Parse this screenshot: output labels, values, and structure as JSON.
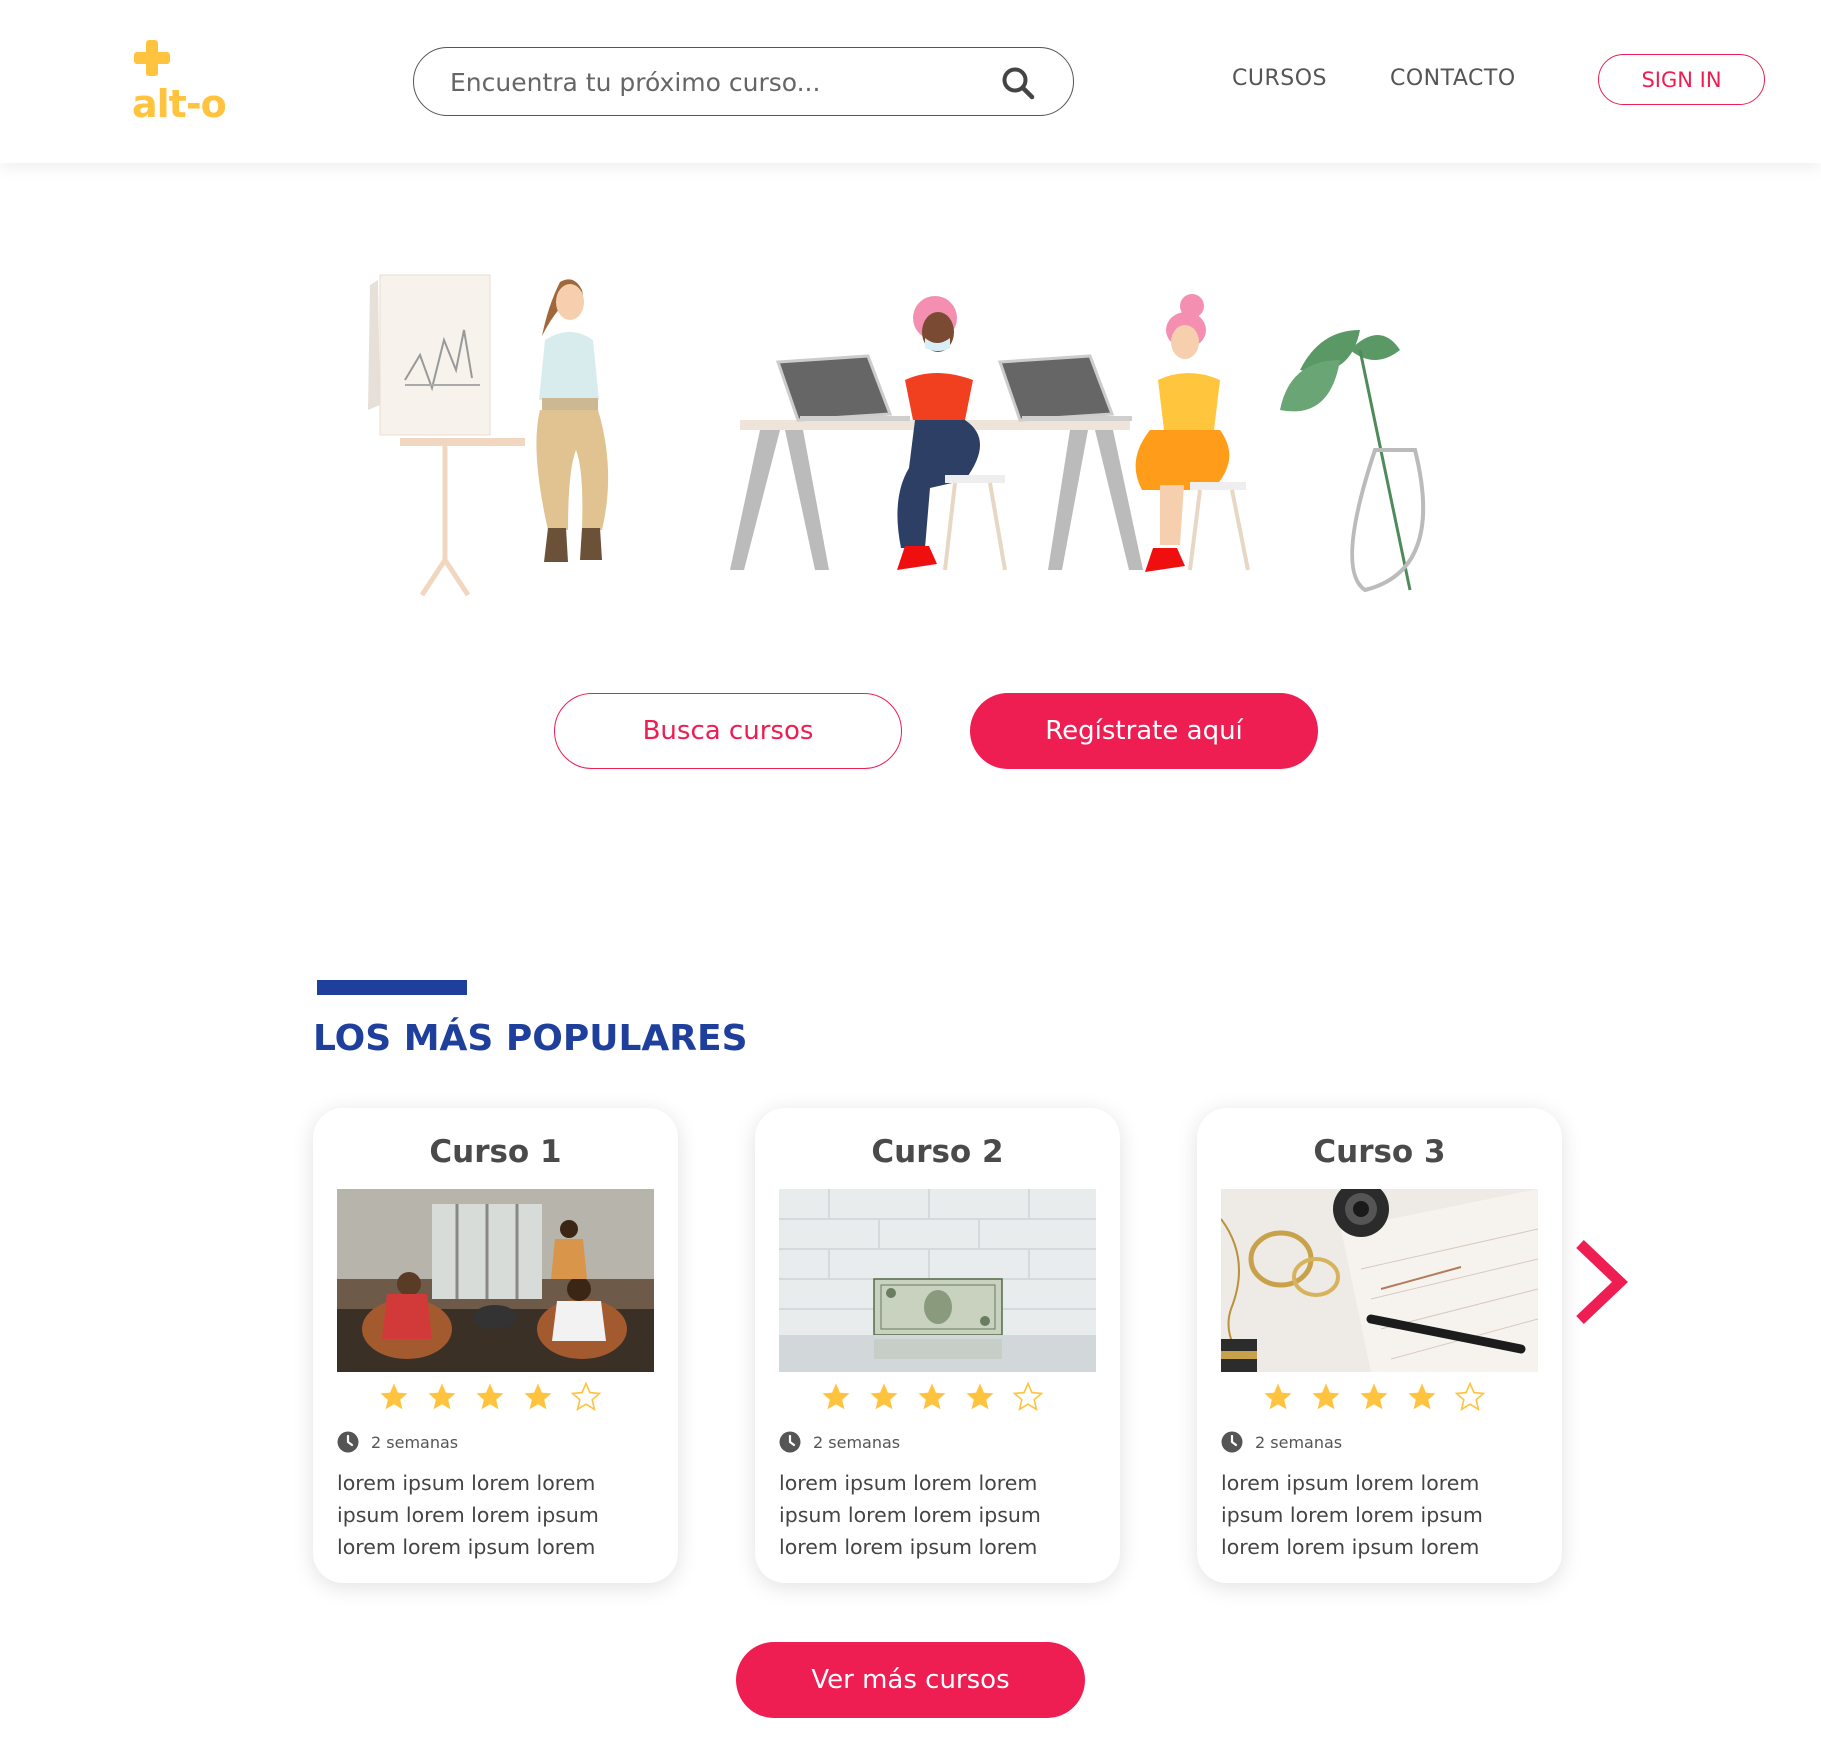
{
  "brand": {
    "name": "alt-o",
    "color": "#ffc33d"
  },
  "colors": {
    "accent": "#ee1d52",
    "heading": "#1e3f9b",
    "star": "#ffc33d"
  },
  "search": {
    "placeholder": "Encuentra tu próximo curso...",
    "icon": "search-icon"
  },
  "nav": {
    "cursos": "CURSOS",
    "contacto": "CONTACTO",
    "signin": "SIGN IN"
  },
  "hero": {
    "busca_label": "Busca cursos",
    "registro_label": "Regístrate aquí"
  },
  "popular": {
    "title": "LOS MÁS POPULARES",
    "cards": [
      {
        "title": "Curso 1",
        "rating": 4,
        "max_rating": 5,
        "duration": "2 semanas",
        "description": "lorem ipsum lorem lorem ipsum lorem lorem ipsum lorem lorem ipsum lorem"
      },
      {
        "title": "Curso 2",
        "rating": 4,
        "max_rating": 5,
        "duration": "2 semanas",
        "description": "lorem ipsum lorem lorem ipsum lorem lorem ipsum lorem lorem ipsum lorem"
      },
      {
        "title": "Curso 3",
        "rating": 4,
        "max_rating": 5,
        "duration": "2 semanas",
        "description": "lorem ipsum lorem lorem ipsum lorem lorem ipsum lorem lorem ipsum lorem"
      }
    ],
    "next_icon": "chevron-right-icon",
    "ver_mas_label": "Ver más cursos"
  }
}
